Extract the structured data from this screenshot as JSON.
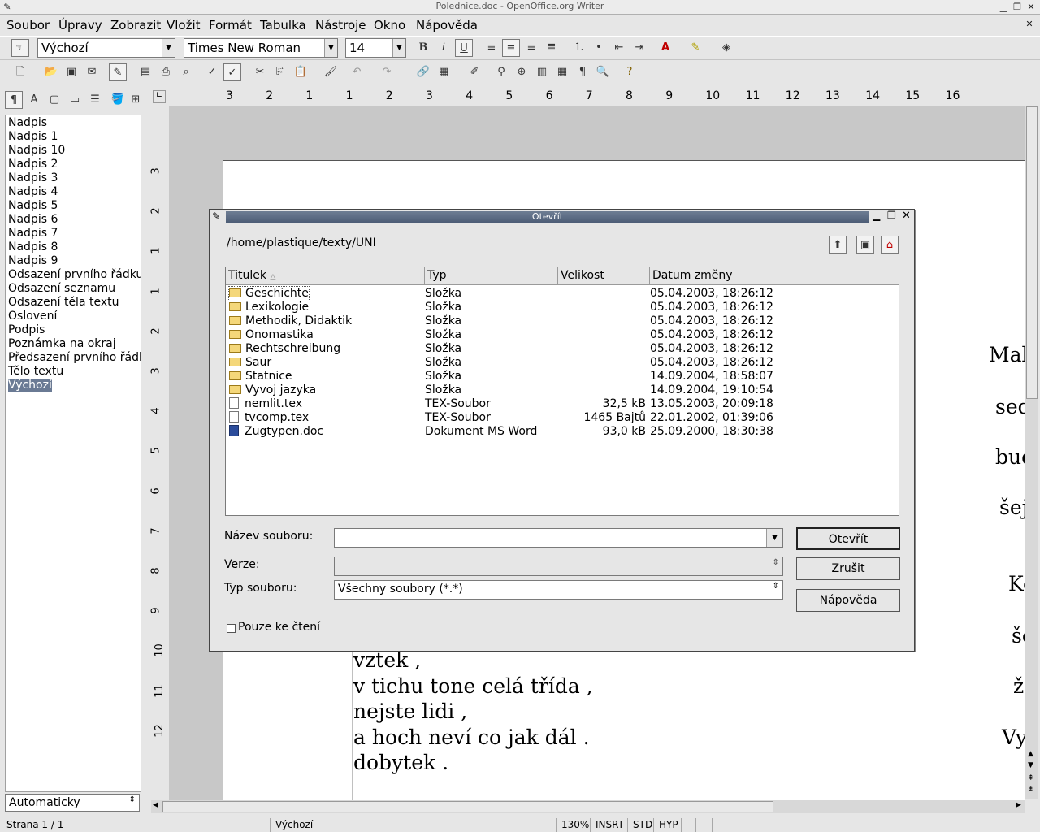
{
  "window": {
    "title": "Polednice.doc - OpenOffice.org Writer"
  },
  "menu": [
    "Soubor",
    "Úpravy",
    "Zobrazit",
    "Vložit",
    "Formát",
    "Tabulka",
    "Nástroje",
    "Okno",
    "Nápověda"
  ],
  "toolbar": {
    "paragraph_style": "Výchozí",
    "font_name": "Times New Roman",
    "font_size": "14"
  },
  "styles_panel": {
    "items": [
      "Nadpis",
      "Nadpis 1",
      "Nadpis 10",
      "Nadpis 2",
      "Nadpis 3",
      "Nadpis 4",
      "Nadpis 5",
      "Nadpis 6",
      "Nadpis 7",
      "Nadpis 8",
      "Nadpis 9",
      "Odsazení prvního řádku",
      "Odsazení seznamu",
      "Odsazení těla textu",
      "Oslovení",
      "Podpis",
      "Poznámka na okraj",
      "Předsazení prvního řádk",
      "Tělo textu",
      "Výchozí"
    ],
    "selected": "Výchozí",
    "filter": "Automaticky"
  },
  "ruler": {
    "h_marks": [
      "3",
      "2",
      "1",
      "1",
      "2",
      "3",
      "4",
      "5",
      "6",
      "7",
      "8",
      "9",
      "10",
      "11",
      "12",
      "13",
      "14",
      "15",
      "16"
    ],
    "v_marks": [
      "3",
      "2",
      "1",
      "1",
      "2",
      "3",
      "4",
      "5",
      "6",
      "7",
      "8",
      "9",
      "10",
      "11",
      "12"
    ]
  },
  "document": {
    "lines": [
      "vztek ,",
      "v tichu tone celá třída ,",
      "nejste lidi ,",
      "a hoch neví co jak dál .",
      "dobytek ."
    ],
    "right_column": [
      "Mal",
      "sed",
      "bud",
      "šej",
      "Ko",
      "še",
      "ža",
      "Vy"
    ]
  },
  "dialog": {
    "title": "Otevřít",
    "path": "/home/plastique/texty/UNI",
    "columns": {
      "name": "Titulek",
      "type": "Typ",
      "size": "Velikost",
      "date": "Datum změny"
    },
    "files": [
      {
        "name": "Geschichte",
        "type": "Složka",
        "size": "",
        "date": "05.04.2003, 18:26:12",
        "kind": "folder"
      },
      {
        "name": "Lexikologie",
        "type": "Složka",
        "size": "",
        "date": "05.04.2003, 18:26:12",
        "kind": "folder"
      },
      {
        "name": "Methodik, Didaktik",
        "type": "Složka",
        "size": "",
        "date": "05.04.2003, 18:26:12",
        "kind": "folder"
      },
      {
        "name": "Onomastika",
        "type": "Složka",
        "size": "",
        "date": "05.04.2003, 18:26:12",
        "kind": "folder"
      },
      {
        "name": "Rechtschreibung",
        "type": "Složka",
        "size": "",
        "date": "05.04.2003, 18:26:12",
        "kind": "folder"
      },
      {
        "name": "Saur",
        "type": "Složka",
        "size": "",
        "date": "05.04.2003, 18:26:12",
        "kind": "folder"
      },
      {
        "name": "Statnice",
        "type": "Složka",
        "size": "",
        "date": "14.09.2004, 18:58:07",
        "kind": "folder"
      },
      {
        "name": "Vyvoj jazyka",
        "type": "Složka",
        "size": "",
        "date": "14.09.2004, 19:10:54",
        "kind": "folder"
      },
      {
        "name": "nemlit.tex",
        "type": "TEX-Soubor",
        "size": "32,5 kB",
        "date": "13.05.2003, 20:09:18",
        "kind": "file"
      },
      {
        "name": "tvcomp.tex",
        "type": "TEX-Soubor",
        "size": "1465 Bajtů",
        "date": "22.01.2002, 01:39:06",
        "kind": "file"
      },
      {
        "name": "Zugtypen.doc",
        "type": "Dokument MS Word",
        "size": "93,0 kB",
        "date": "25.09.2000, 18:30:38",
        "kind": "word"
      }
    ],
    "filename_label": "Název souboru:",
    "filename_value": "",
    "version_label": "Verze:",
    "filetype_label": "Typ souboru:",
    "filetype_value": "Všechny soubory (*.*)",
    "readonly_label": "Pouze ke čtení",
    "open_button": "Otevřít",
    "cancel_button": "Zrušit",
    "help_button": "Nápověda"
  },
  "status": {
    "page": "Strana 1 / 1",
    "style": "Výchozí",
    "zoom": "130%",
    "insert": "INSRT",
    "selection": "STD",
    "hyphen": "HYP"
  }
}
